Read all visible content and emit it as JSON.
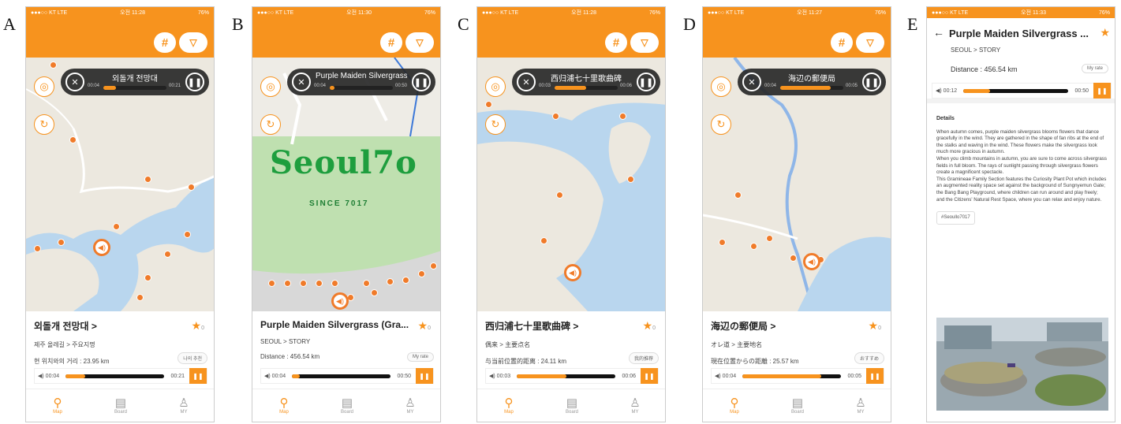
{
  "panel_letters": [
    "A",
    "B",
    "C",
    "D",
    "E"
  ],
  "status": {
    "left": "●●●○○ KT  LTE",
    "time_a": "오전 11:28",
    "time_b": "오전 11:30",
    "time_c": "오전 11:28",
    "time_d": "오전 11:27",
    "time_e": "오전 11:33",
    "battery": "76%"
  },
  "topbar": {
    "hash": "#",
    "filter": "▽"
  },
  "mapbtns": {
    "locate": "◎",
    "recent": "↻"
  },
  "tabs": [
    {
      "icon": "⚲",
      "label": "Map"
    },
    {
      "icon": "▤",
      "label": "Board"
    },
    {
      "icon": "♙",
      "label": "MY"
    }
  ],
  "panels": [
    {
      "player_title": "외돌개 전망대",
      "player_t1": "00:04",
      "player_t2": "00:21",
      "name": "외돌개 전망대 >",
      "star_count": "0",
      "crumb": "제주 올레길 > 주요지명",
      "dist": "현 위치와의 거리 : 23.95 km",
      "rate": "나의 추천",
      "audio_t1": "00:04",
      "audio_t2": "00:21",
      "progress": 0.2
    },
    {
      "player_title": "Purple Maiden Silvergrass (Gra...",
      "player_t1": "00:04",
      "player_t2": "00:50",
      "name": "Purple Maiden Silvergrass (Gra...",
      "star_count": "0",
      "crumb": "SEOUL > STORY",
      "dist": "Distance : 456.54 km",
      "rate": "My rate",
      "audio_t1": "00:04",
      "audio_t2": "00:50",
      "progress": 0.08,
      "logo": "Seoul7o",
      "logo_sub": "SINCE 7017"
    },
    {
      "player_title": "西归浦七十里歌曲碑",
      "player_t1": "00:03",
      "player_t2": "00:06",
      "name": "西归浦七十里歌曲碑 >",
      "star_count": "0",
      "crumb": "偶来 > 主要点名",
      "dist": "与当前位置的距离 : 24.11 km",
      "rate": "我的推荐",
      "audio_t1": "00:03",
      "audio_t2": "00:06",
      "progress": 0.5
    },
    {
      "player_title": "海辺の郵便局",
      "player_t1": "00:04",
      "player_t2": "00:05",
      "name": "海辺の郵便局 >",
      "star_count": "0",
      "crumb": "オレ道 > 主要地名",
      "dist": "現在位置からの距離 : 25.57 km",
      "rate": "おすすめ",
      "audio_t1": "00:04",
      "audio_t2": "00:05",
      "progress": 0.8
    }
  ],
  "detail": {
    "title": "Purple Maiden Silvergrass ...",
    "crumb": "SEOUL > STORY",
    "dist": "Distance :  456.54 km",
    "rate": "My rate",
    "audio_t1": "00:12",
    "audio_t2": "00:50",
    "progress": 0.25,
    "heading": "Details",
    "p1": "When autumn comes, purple maiden silvergrass blooms flowers that dance gracefully in the wind. They are gathered in the shape of fan ribs at the end of the stalks and waving in the wind. These flowers make the silvergrass look much more gracious in autumn.",
    "p2": "When you climb mountains in autumn, you are sure to come across silvergrass fields in full bloom. The rays of sunlight passing through silvergrass flowers create a magnificent spectacle.",
    "p3": "This Gramineae Family Section features the Curiosity Plant Pot which includes an augmented reality space set against the background of Sungnyemun Gate; the Bang Bang Playground, where children can run around and play freely; and the Citizens' Natural Rest Space, where you can relax and enjoy nature.",
    "tag": "#Seoullo7017"
  },
  "colors": {
    "accent": "#f7931e",
    "map_land": "#eae6dc",
    "map_water": "#b8d4ec",
    "player_bg": "#282828"
  }
}
